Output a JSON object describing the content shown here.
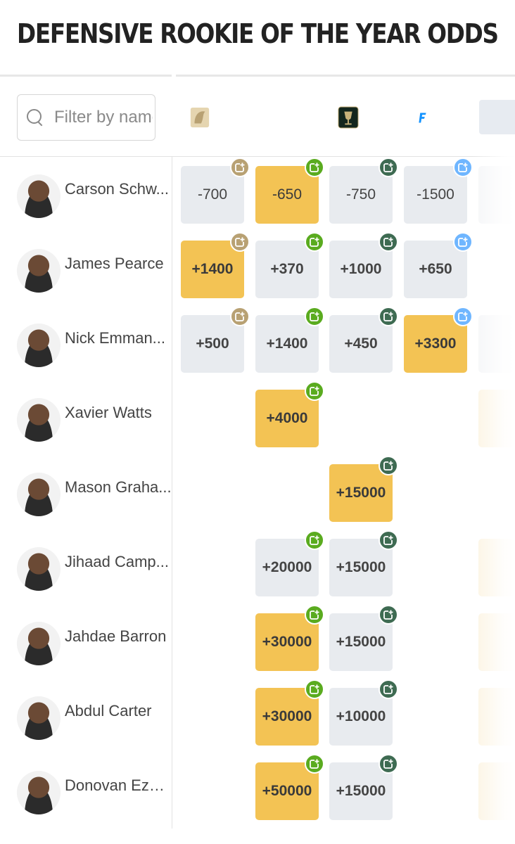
{
  "page": {
    "title": "DEFENSIVE ROOKIE OF THE YEAR ODDS"
  },
  "search": {
    "placeholder": "Filter by name",
    "value": ""
  },
  "colors": {
    "best_odds": "#f3c354",
    "cell_bg": "#e8ebef",
    "betmgm": "#b8a173",
    "draftkings": "#5aab1f",
    "bet365": "#3e6b52",
    "fanduel": "#1493ff"
  },
  "sportsbooks": [
    {
      "name": "BetMGM",
      "icon": "betmgm-lion-logo",
      "color": "#b8a173"
    },
    {
      "name": "DraftKings",
      "icon": "draftkings-crown-logo",
      "color": "#5aab1f"
    },
    {
      "name": "bet365",
      "icon": "chalice-logo",
      "color": "#3e6b52"
    },
    {
      "name": "FanDuel",
      "icon": "fanduel-shield-logo",
      "color": "#1493ff"
    }
  ],
  "players": [
    {
      "name": "Carson Schw...",
      "odds": [
        "-700",
        "-650",
        "-750",
        "-1500"
      ],
      "best": [
        false,
        true,
        false,
        false
      ]
    },
    {
      "name": "James Pearce",
      "odds": [
        "+1400",
        "+370",
        "+1000",
        "+650"
      ],
      "best": [
        true,
        false,
        false,
        false
      ]
    },
    {
      "name": "Nick Emman...",
      "odds": [
        "+500",
        "+1400",
        "+450",
        "+3300"
      ],
      "best": [
        false,
        false,
        false,
        true
      ]
    },
    {
      "name": "Xavier Watts",
      "odds": [
        "",
        "+4000",
        "",
        ""
      ],
      "best": [
        false,
        true,
        false,
        false
      ]
    },
    {
      "name": "Mason Graha...",
      "odds": [
        "",
        "",
        "+15000",
        ""
      ],
      "best": [
        false,
        false,
        true,
        false
      ]
    },
    {
      "name": "Jihaad Camp...",
      "odds": [
        "",
        "+20000",
        "+15000",
        ""
      ],
      "best": [
        false,
        false,
        false,
        false
      ]
    },
    {
      "name": "Jahdae Barron",
      "odds": [
        "",
        "+30000",
        "+15000",
        ""
      ],
      "best": [
        false,
        true,
        false,
        false
      ]
    },
    {
      "name": "Abdul Carter",
      "odds": [
        "",
        "+30000",
        "+10000",
        ""
      ],
      "best": [
        false,
        true,
        false,
        false
      ]
    },
    {
      "name": "Donovan Ezei...",
      "odds": [
        "",
        "+50000",
        "+15000",
        ""
      ],
      "best": [
        false,
        true,
        false,
        false
      ]
    }
  ]
}
